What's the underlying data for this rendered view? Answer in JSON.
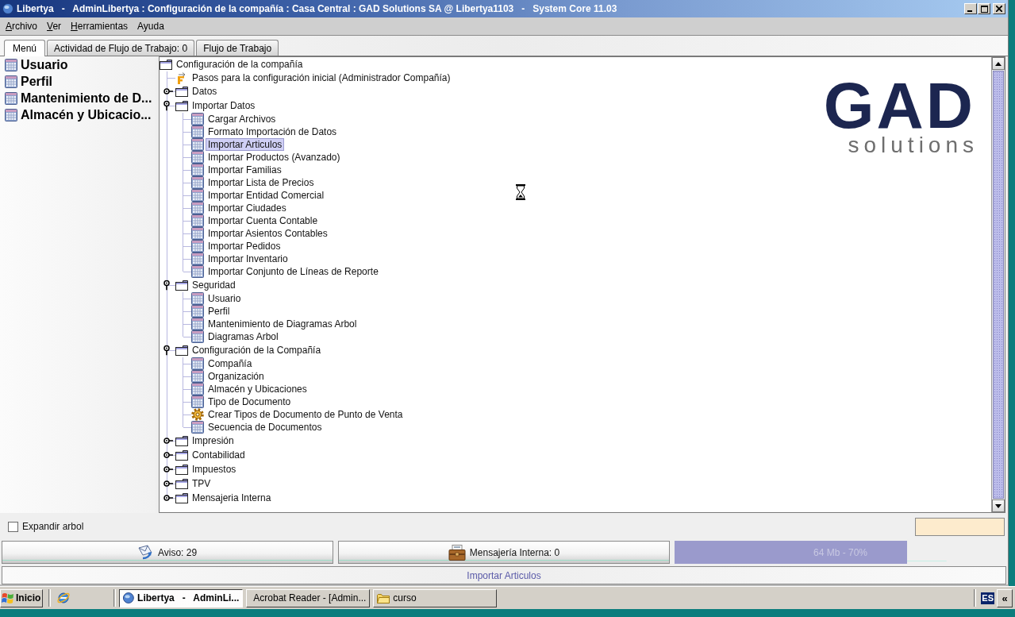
{
  "window": {
    "title": "Libertya   -   AdminLibertya : Configuración de la compañía : Casa Central : GAD Solutions SA @ Libertya1103   -   System Core 11.03"
  },
  "menu_bar": [
    {
      "label": "Archivo",
      "mnemonic": true
    },
    {
      "label": "Ver",
      "mnemonic": true
    },
    {
      "label": "Herramientas",
      "mnemonic": true
    },
    {
      "label": "Ayuda",
      "mnemonic": false
    }
  ],
  "tabs": [
    {
      "label": "Menú",
      "selected": true
    },
    {
      "label": "Actividad de Flujo de Trabajo: 0",
      "selected": false
    },
    {
      "label": "Flujo de Trabajo",
      "selected": false
    }
  ],
  "favorites": [
    {
      "label": "Usuario"
    },
    {
      "label": "Perfil"
    },
    {
      "label": "Mantenimiento de D..."
    },
    {
      "label": "Almacén y Ubicacio..."
    }
  ],
  "tree": {
    "root": {
      "label": "Configuración de la compañía",
      "kind": "folder",
      "selected": false,
      "children": [
        {
          "label": "Pasos para la configuración inicial (Administrador Compañía)",
          "kind": "workflow",
          "selected": false
        },
        {
          "label": "Datos",
          "kind": "folder",
          "expanded": false,
          "selected": false
        },
        {
          "label": "Importar Datos",
          "kind": "folder",
          "expanded": true,
          "selected": false,
          "children": [
            {
              "label": "Cargar Archivos",
              "kind": "window",
              "selected": false
            },
            {
              "label": "Formato Importación de Datos",
              "kind": "window",
              "selected": false
            },
            {
              "label": "Importar Articulos",
              "kind": "window",
              "selected": true
            },
            {
              "label": "Importar Productos (Avanzado)",
              "kind": "window",
              "selected": false
            },
            {
              "label": "Importar Familias",
              "kind": "window",
              "selected": false
            },
            {
              "label": "Importar Lista de Precios",
              "kind": "window",
              "selected": false
            },
            {
              "label": "Importar Entidad Comercial",
              "kind": "window",
              "selected": false
            },
            {
              "label": "Importar Ciudades",
              "kind": "window",
              "selected": false
            },
            {
              "label": "Importar Cuenta Contable",
              "kind": "window",
              "selected": false
            },
            {
              "label": "Importar Asientos Contables",
              "kind": "window",
              "selected": false
            },
            {
              "label": "Importar Pedidos",
              "kind": "window",
              "selected": false
            },
            {
              "label": "Importar Inventario",
              "kind": "window",
              "selected": false
            },
            {
              "label": "Importar Conjunto de Líneas de Reporte",
              "kind": "window",
              "selected": false
            }
          ]
        },
        {
          "label": "Seguridad",
          "kind": "folder",
          "expanded": true,
          "selected": false,
          "children": [
            {
              "label": "Usuario",
              "kind": "window",
              "selected": false
            },
            {
              "label": "Perfil",
              "kind": "window",
              "selected": false
            },
            {
              "label": "Mantenimiento de Diagramas Arbol",
              "kind": "window",
              "selected": false
            },
            {
              "label": "Diagramas Arbol",
              "kind": "window",
              "selected": false
            }
          ]
        },
        {
          "label": "Configuración de la Compañía",
          "kind": "folder",
          "expanded": true,
          "selected": false,
          "children": [
            {
              "label": "Compañía",
              "kind": "window",
              "selected": false
            },
            {
              "label": "Organización",
              "kind": "window",
              "selected": false
            },
            {
              "label": "Almacén y Ubicaciones",
              "kind": "window",
              "selected": false
            },
            {
              "label": "Tipo de Documento",
              "kind": "window",
              "selected": false
            },
            {
              "label": "Crear Tipos de Documento de Punto de Venta",
              "kind": "process",
              "selected": false
            },
            {
              "label": "Secuencia de Documentos",
              "kind": "window",
              "selected": false
            }
          ]
        },
        {
          "label": "Impresión",
          "kind": "folder",
          "expanded": false,
          "selected": false
        },
        {
          "label": "Contabilidad",
          "kind": "folder",
          "expanded": false,
          "selected": false
        },
        {
          "label": "Impuestos",
          "kind": "folder",
          "expanded": false,
          "selected": false
        },
        {
          "label": "TPV",
          "kind": "folder",
          "expanded": false,
          "selected": false
        },
        {
          "label": "Mensajeria Interna",
          "kind": "folder",
          "expanded": false,
          "selected": false
        }
      ]
    }
  },
  "logo": {
    "name": "GAD",
    "tagline": "solutions"
  },
  "expand_tree": {
    "label": "Expandir arbol",
    "checked": false
  },
  "status_buttons": [
    {
      "label": "Aviso: 29",
      "kind": "notices"
    },
    {
      "label": "Mensajería Interna: 0",
      "kind": "messages"
    }
  ],
  "memory": {
    "reading": "64 Mb - 70%",
    "level": 0.7
  },
  "status_line": {
    "text": "Importar Articulos"
  },
  "taskbar": {
    "start": "Inicio",
    "tasks": [
      {
        "label": "Libertya   -   AdminLi...",
        "kind": "app",
        "selected": true
      },
      {
        "label": "Acrobat Reader - [Admin...",
        "kind": "pdf",
        "selected": false
      },
      {
        "label": "curso",
        "kind": "folder",
        "selected": false
      }
    ],
    "language": "ES",
    "tray_toggle": "«"
  }
}
